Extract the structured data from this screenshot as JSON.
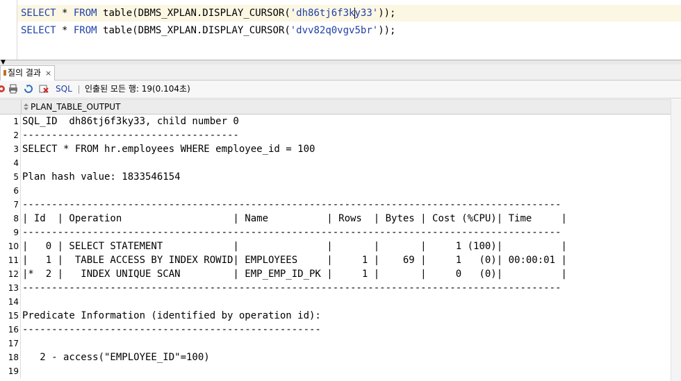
{
  "editor": {
    "lines": [
      {
        "kw1": "SELECT",
        "star": " * ",
        "kw2": "FROM",
        "fn": " table(DBMS_XPLAN.DISPLAY_CURSOR(",
        "str_a": "'dh86tj6f3k",
        "str_b": "y33'",
        "end": "));"
      },
      {
        "kw1": "SELECT",
        "star": " * ",
        "kw2": "FROM",
        "fn": " table(DBMS_XPLAN.DISPLAY_CURSOR(",
        "str_a": "'dvv82q0vgv5br'",
        "str_b": "",
        "end": "));"
      }
    ]
  },
  "results_tab": {
    "label": "질의 결과",
    "close": "×"
  },
  "toolbar": {
    "sql_label": "SQL",
    "status": "인출된 모든 행: 19(0.104초)"
  },
  "grid": {
    "column_header": "PLAN_TABLE_OUTPUT",
    "rows": [
      {
        "n": "1",
        "text": "SQL_ID  dh86tj6f3ky33, child number 0"
      },
      {
        "n": "2",
        "text": "-------------------------------------"
      },
      {
        "n": "3",
        "text": "SELECT * FROM hr.employees WHERE employee_id = 100"
      },
      {
        "n": "4",
        "text": ""
      },
      {
        "n": "5",
        "text": "Plan hash value: 1833546154"
      },
      {
        "n": "6",
        "text": ""
      },
      {
        "n": "7",
        "text": "--------------------------------------------------------------------------------------------"
      },
      {
        "n": "8",
        "text": "| Id  | Operation                   | Name          | Rows  | Bytes | Cost (%CPU)| Time     |"
      },
      {
        "n": "9",
        "text": "--------------------------------------------------------------------------------------------"
      },
      {
        "n": "10",
        "text": "|   0 | SELECT STATEMENT            |               |       |       |     1 (100)|          |"
      },
      {
        "n": "11",
        "text": "|   1 |  TABLE ACCESS BY INDEX ROWID| EMPLOYEES     |     1 |    69 |     1   (0)| 00:00:01 |"
      },
      {
        "n": "12",
        "text": "|*  2 |   INDEX UNIQUE SCAN         | EMP_EMP_ID_PK |     1 |       |     0   (0)|          |"
      },
      {
        "n": "13",
        "text": "--------------------------------------------------------------------------------------------"
      },
      {
        "n": "14",
        "text": ""
      },
      {
        "n": "15",
        "text": "Predicate Information (identified by operation id):"
      },
      {
        "n": "16",
        "text": "---------------------------------------------------"
      },
      {
        "n": "17",
        "text": ""
      },
      {
        "n": "18",
        "text": "   2 - access(\"EMPLOYEE_ID\"=100)"
      },
      {
        "n": "19",
        "text": ""
      }
    ]
  },
  "colors": {
    "keyword": "#1f3fa8",
    "current_line": "#fbf7e3"
  }
}
